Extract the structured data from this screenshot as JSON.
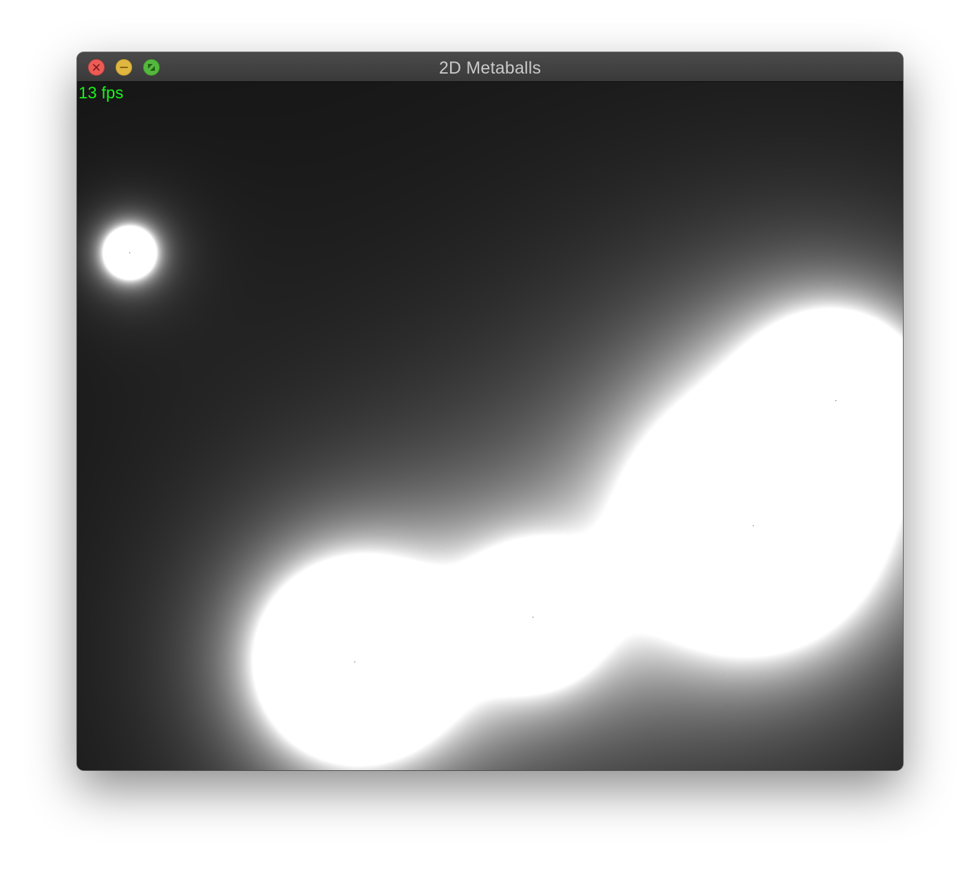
{
  "window": {
    "title": "2D Metaballs",
    "controls": {
      "close": "close-icon",
      "minimize": "minimize-icon",
      "zoom": "fullscreen-icon"
    }
  },
  "overlay": {
    "fps_label": "13 fps"
  },
  "colors": {
    "fps_text": "#1cf21c",
    "background": "#1a1a1a",
    "blob": "#ffffff"
  }
}
